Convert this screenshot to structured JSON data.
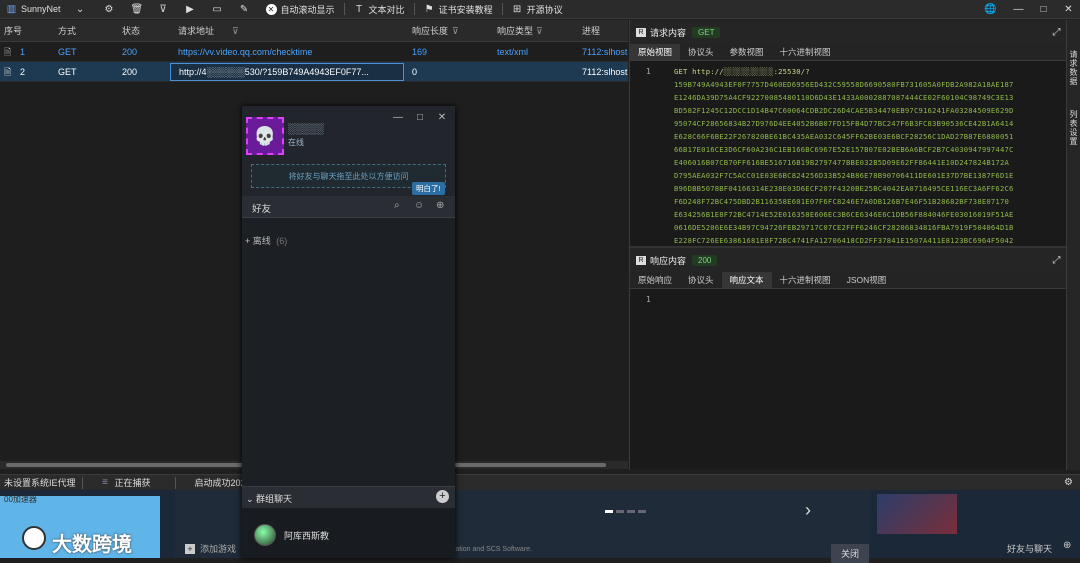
{
  "toolbar": {
    "app_name": "SunnyNet",
    "auto_scroll": "自动滚动显示",
    "text_compare": "文本对比",
    "cert_install": "证书安装教程",
    "open_source": "开源协议"
  },
  "list": {
    "headers": [
      "序号",
      "方式",
      "状态",
      "请求地址",
      "响应长度",
      "响应类型",
      "进程"
    ],
    "rows": [
      {
        "id": "1",
        "method": "GET",
        "status": "200",
        "url": "https://vv.video.qq.com/checktime",
        "len": "169",
        "type": "text/xml",
        "proc": "7112:slhost"
      },
      {
        "id": "2",
        "method": "GET",
        "status": "200",
        "url": "http://4░░░░░░530/?159B749A4943EF0F77...",
        "len": "0",
        "type": "",
        "proc": "7112:slhost"
      }
    ]
  },
  "status": {
    "proxy": "未设置系统IE代理",
    "capturing": "正在捕获",
    "started": "启动成功202"
  },
  "request_panel": {
    "title": "请求内容",
    "method": "GET",
    "tabs": [
      "原始视图",
      "协议头",
      "参数视图",
      "十六进制视图"
    ],
    "line_no": "1",
    "first_line": "GET  http://░░░░░░░░░░░:25530/?",
    "hex_lines": [
      "159B749A4943EF0F7757D460ED6956ED432C59558D6690580FB731605A0FDB2A982A18AE187",
      "E1246DA39D75A4CF92270085480110D6D43E1433A0002887087444CE02F60104C98749C3E13",
      "BD582F1245C12DCC1D14B47C60064CDB2DC26D4CAE5B34470EB97C916241FA03284509E629D",
      "95074CF28656834B27D976D4EE4052B6B07FD15FB4D77BC247F6B3FC83B90536CE42B1A6414",
      "E628C66F6BE22F267820BE61BC435AEA032C645FF62BE03E6BCF28256C1DAD27B87E6880051",
      "66B17E016CE3D6CF60A236C1EB166BC6967E52E157B07E02BEB6A6BCF2B7C4030947997447C",
      "E406016B07CB70FF616BE516716B19B2797477BBE032B5D09E62FF86441E10D247824B172A",
      "D795AEA032F7C5ACC01E03E6BC824256D33B524B86E78B90706411DE601E37D7BE1387F6D1E",
      "B96DBB5078BF04166314E238E03D6ECF207F4320BE25BC4042EA0716495CE116EC3A6FF62C6",
      "F6D248F72BC475DBD2B116358E601E07F6FC8246E7A0DB126B7E46F51B28682BF738E07170",
      "E634256B1E8F72BC4714E52E016358E606EC3B6CE6346E6C1DB56F884046FE03016019F51AE",
      "0616DE5206E6E34B97C94726FEB29717C07CE2FFF6246CF28206834816FBA7919F504064D1B",
      "E228FC726EE63861681E8F72BC4741FA12706418CD2FF37841E1507A411E8123BC6964F5042"
    ]
  },
  "response_panel": {
    "title": "响应内容",
    "status": "200",
    "tabs": [
      "原始响应",
      "协议头",
      "响应文本",
      "十六进制视图",
      "JSON视图"
    ],
    "line_no": "1"
  },
  "vtabs": {
    "a": "请求数据",
    "b": "列表设置"
  },
  "qq": {
    "name": "░░░░░",
    "status": "在线",
    "hint": "将好友与聊天拖至此处以方便访问",
    "got_it": "明白了!",
    "friends": "好友",
    "offline": "+ 离线",
    "offline_count": "(6)",
    "group_chat": "群组聊天",
    "contact": "阿库西斯教"
  },
  "bottom": {
    "left_text": "大数跨境",
    "left_subtitle": "00加速器",
    "add_game": "添加游戏",
    "footer_text": "ration and SCS Software.",
    "close": "关闭",
    "friends_chat": "好友与聊天"
  }
}
